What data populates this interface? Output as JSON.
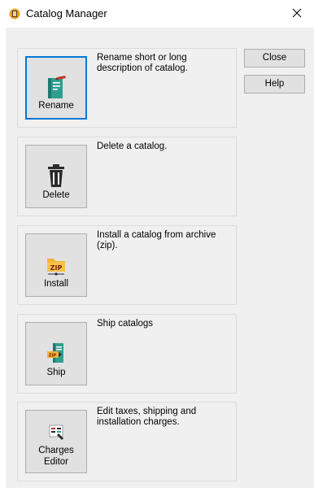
{
  "window": {
    "title": "Catalog Manager",
    "close_glyph": "✕"
  },
  "side_buttons": {
    "close_label": "Close",
    "help_label": "Help"
  },
  "actions": [
    {
      "id": "rename",
      "label": "Rename",
      "description": "Rename short or long description of catalog.",
      "icon": "rename-book-icon",
      "focused": true
    },
    {
      "id": "delete",
      "label": "Delete",
      "description": "Delete a catalog.",
      "icon": "trash-can-icon",
      "focused": false
    },
    {
      "id": "install",
      "label": "Install",
      "description": "Install a catalog from archive (zip).",
      "icon": "zip-folder-icon",
      "zip_text": "ZIP",
      "focused": false
    },
    {
      "id": "ship",
      "label": "Ship",
      "description": "Ship catalogs",
      "icon": "ship-zip-icon",
      "zip_text": "ZIP",
      "focused": false
    },
    {
      "id": "charges",
      "label_line1": "Charges",
      "label_line2": "Editor",
      "description": "Edit taxes, shipping and installation charges.",
      "icon": "charges-editor-icon",
      "focused": false
    }
  ],
  "colors": {
    "accent_focus": "#0078d7",
    "client_bg": "#f0f0f0",
    "button_bg": "#e1e1e1"
  }
}
